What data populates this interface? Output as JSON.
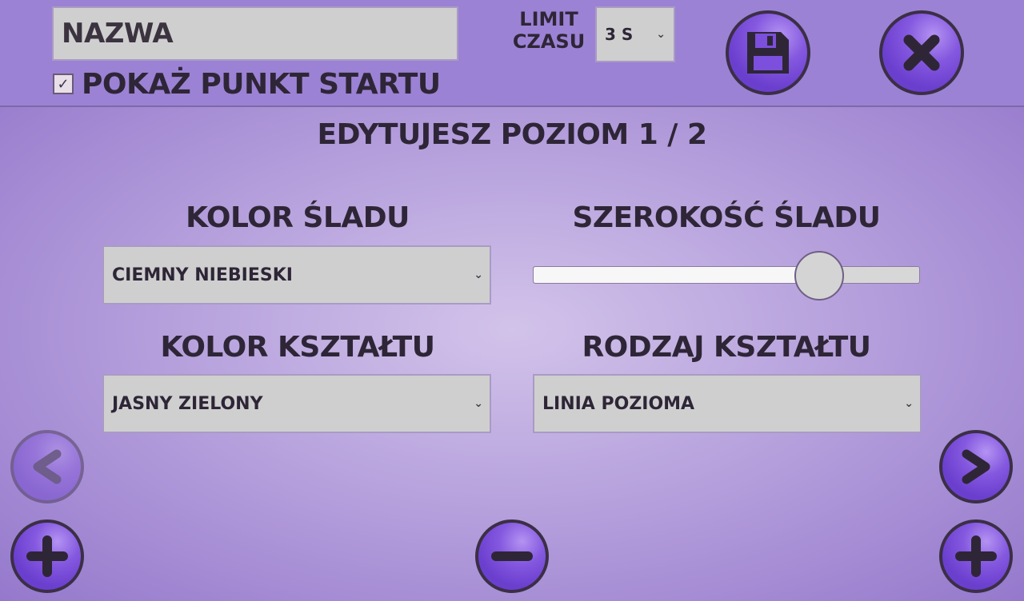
{
  "header": {
    "name_value": "NAZWA",
    "show_start_checked": true,
    "show_start_label": "POKAŻ PUNKT STARTU",
    "time_limit_label_line1": "LIMIT",
    "time_limit_label_line2": "CZASU",
    "time_limit_value": "3 S",
    "save_icon": "floppy-disk-icon",
    "close_icon": "close-x-icon"
  },
  "editor": {
    "title": "EDYTUJESZ POZIOM 1 / 2",
    "trail_color_label": "KOLOR ŚLADU",
    "trail_color_value": "CIEMNY NIEBIESKI",
    "trail_width_label": "SZEROKOŚĆ ŚLADU",
    "trail_width_fraction": 0.74,
    "shape_color_label": "KOLOR KSZTAŁTU",
    "shape_color_value": "JASNY ZIELONY",
    "shape_type_label": "RODZAJ KSZTAŁTU",
    "shape_type_value": "LINIA POZIOMA"
  },
  "navigation": {
    "prev_enabled": false,
    "next_enabled": true,
    "icons": [
      "chevron-left-icon",
      "chevron-right-icon",
      "plus-icon",
      "minus-icon",
      "plus-icon"
    ]
  },
  "colors": {
    "accent": "#7c4fdc",
    "icon_dark": "#2e2637",
    "panel_center": "#d2c3ea"
  }
}
